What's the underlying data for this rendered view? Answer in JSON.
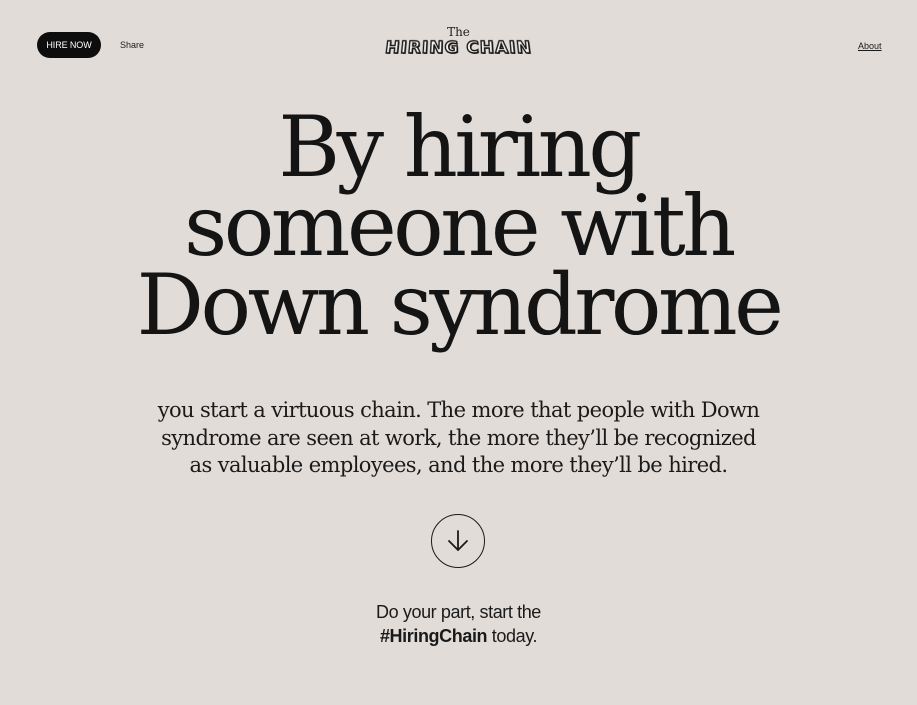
{
  "header": {
    "hire_button": "HIRE NOW",
    "share_link": "Share",
    "about_link": "About",
    "logo": {
      "the": "The",
      "name": "HIRING CHAIN"
    }
  },
  "hero": {
    "headline": [
      "By hiring",
      "someone with",
      "Down syndrome"
    ],
    "subtext": [
      "you start a virtuous chain. The more that people with Down",
      "syndrome are seen at work, the more they’ll be recognized",
      "as valuable employees, and the more they’ll be hired."
    ],
    "scroll_icon": "arrow-down-icon"
  },
  "cta": {
    "line1": "Do your part, start the",
    "hashtag": "#HiringChain",
    "suffix": " today."
  },
  "colors": {
    "background": "#e2dcd8",
    "text": "#141414",
    "button_bg": "#0d0d0d",
    "button_text": "#ffffff"
  }
}
